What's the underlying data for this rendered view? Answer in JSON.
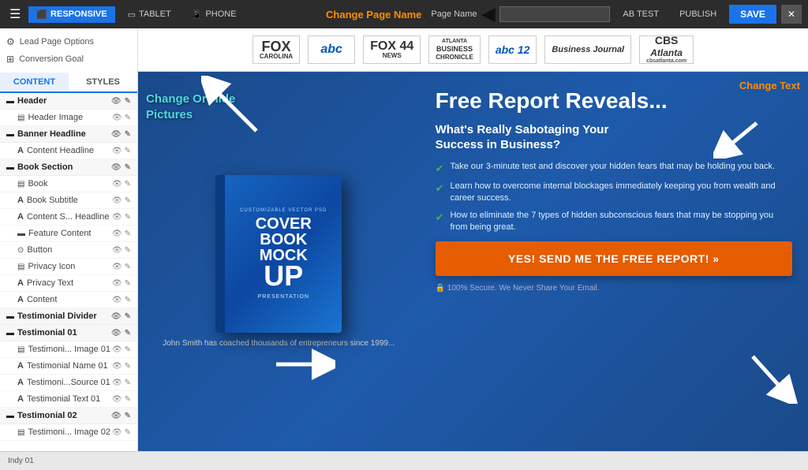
{
  "topbar": {
    "menu_icon": "☰",
    "responsive_label": "RESPONSIVE",
    "tablet_label": "TABLET",
    "phone_label": "PHONE",
    "page_name_label": "Page Name",
    "page_name_placeholder": "",
    "change_page_name": "Change Page Name",
    "ab_test_label": "AB TEST",
    "publish_label": "PUBLISH",
    "save_label": "SAVE",
    "close_label": "✕"
  },
  "sidebar": {
    "options": [
      {
        "icon": "⚙",
        "label": "Lead Page Options"
      },
      {
        "icon": "⊞",
        "label": "Conversion Goal"
      }
    ],
    "tabs": [
      {
        "label": "CONTENT",
        "active": true
      },
      {
        "label": "STYLES",
        "active": false
      }
    ],
    "sections": [
      {
        "label": "Header",
        "type": "section",
        "icon": "▬"
      },
      {
        "label": "Header Image",
        "type": "sub",
        "icon": "▤"
      },
      {
        "label": "Banner Headline",
        "type": "section",
        "icon": "▬"
      },
      {
        "label": "Content Headline",
        "type": "sub",
        "icon": "A"
      },
      {
        "label": "Book Section",
        "type": "section",
        "icon": "▬"
      },
      {
        "label": "Book",
        "type": "sub",
        "icon": "▤"
      },
      {
        "label": "Book Subtitle",
        "type": "sub",
        "icon": "A"
      },
      {
        "label": "Content S... Headline",
        "type": "sub",
        "icon": "A"
      },
      {
        "label": "Feature Content",
        "type": "sub",
        "icon": "▬"
      },
      {
        "label": "Button",
        "type": "sub",
        "icon": "⊙"
      },
      {
        "label": "Privacy Icon",
        "type": "sub",
        "icon": "▤"
      },
      {
        "label": "Privacy Text",
        "type": "sub",
        "icon": "A"
      },
      {
        "label": "Content",
        "type": "sub",
        "icon": "A"
      },
      {
        "label": "Testimonial Divider",
        "type": "section",
        "icon": "▬"
      },
      {
        "label": "Testimonial 01",
        "type": "section",
        "icon": "▬"
      },
      {
        "label": "Testimoni... Image 01",
        "type": "sub",
        "icon": "▤"
      },
      {
        "label": "Testimonial Name 01",
        "type": "sub",
        "icon": "A"
      },
      {
        "label": "Testimoni...Source 01",
        "type": "sub",
        "icon": "A"
      },
      {
        "label": "Testimonial Text 01",
        "type": "sub",
        "icon": "A"
      },
      {
        "label": "Testimonial 02",
        "type": "section",
        "icon": "▬"
      },
      {
        "label": "Testimoni... Image 02",
        "type": "sub",
        "icon": "▤"
      }
    ]
  },
  "logos": [
    {
      "id": "fox-carolina",
      "line1": "FOX",
      "line2": "CAROLINA"
    },
    {
      "id": "abc",
      "line1": "abc"
    },
    {
      "id": "fox44",
      "line1": "FOX",
      "line2": "44",
      "line3": "NEWS"
    },
    {
      "id": "atlanta-business-chronicle",
      "line1": "ATLANTA",
      "line2": "BUSINESS",
      "line3": "CHRONICLE"
    },
    {
      "id": "abc12",
      "line1": "abc",
      "line2": "12"
    },
    {
      "id": "business-journal",
      "line1": "Business Journal"
    },
    {
      "id": "cbs-atlanta",
      "line1": "CBS",
      "line2": "Atlanta",
      "line3": "cbsatlanta.com"
    }
  ],
  "main": {
    "change_hide_label": "Change Or Hide\nPictures",
    "change_text_label": "Change Text",
    "book": {
      "top_text": "CUSTOMIZABLE VECTOR PSD",
      "line1": "COVER",
      "line2": "BOOK",
      "line3": "MOCK",
      "line4": "UP",
      "sub_text": "PRESENTATION",
      "caption": "John Smith has coached thousands of entrepreneurs since 1999..."
    },
    "headline": "Free Report Reveals...",
    "subtitle": "What's Really Sabotaging Your\nSuccess in Business?",
    "bullets": [
      "Take our 3-minute test and discover your hidden fears that may be holding you back.",
      "Learn how to overcome internal blockages immediately keeping you from wealth and career success.",
      "How to eliminate the 7 types of hidden subconscious fears that may be stopping you from being great."
    ],
    "cta_button": "YES! SEND ME THE FREE REPORT! »",
    "secure_text": "🔒  100% Secure. We Never Share Your Email."
  },
  "statusbar": {
    "text": "Indy 01"
  }
}
